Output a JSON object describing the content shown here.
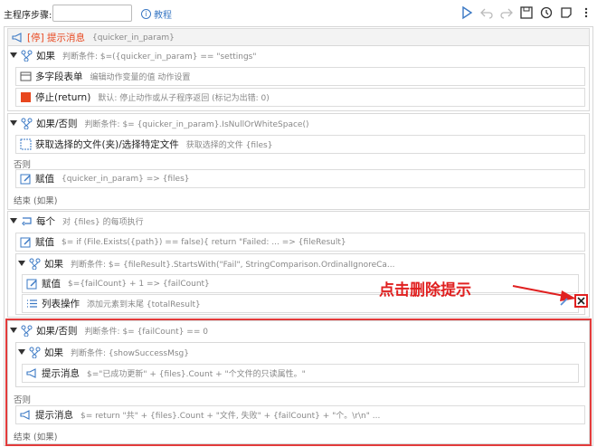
{
  "toolbar": {
    "label": "主程序步骤:",
    "search_value": "",
    "help_label": "教程"
  },
  "steps": {
    "s1": {
      "title": "[停] 提示消息",
      "desc": "{quicker_in_param}"
    },
    "s2": {
      "title": "如果",
      "desc": "判断条件: $=({quicker_in_param} == \"settings\""
    },
    "s2a": {
      "title": "多字段表单",
      "desc": "编辑动作变量的值 动作设置"
    },
    "s2b": {
      "title": "停止(return)",
      "desc": "默认:  停止动作或从子程序返回 (标记为出错: 0)"
    },
    "s3": {
      "title": "如果/否则",
      "desc": "判断条件: $= {quicker_in_param}.IsNullOrWhiteSpace()"
    },
    "s3a": {
      "title": "获取选择的文件(夹)/选择特定文件",
      "desc": "获取选择的文件 {files}"
    },
    "s3_else": "否则",
    "s3b": {
      "title": "赋值",
      "desc": "{quicker_in_param} => {files}"
    },
    "s3_end": "结束 (如果)",
    "s4": {
      "title": "每个",
      "desc": "对 {files} 的每项执行"
    },
    "s4a": {
      "title": "赋值",
      "desc": "$=  if (File.Exists({path}) == false){             return \"Failed: ... => {fileResult}"
    },
    "s4b": {
      "title": "如果",
      "desc": "判断条件: $= {fileResult}.StartsWith(\"Fail\", StringComparison.OrdinalIgnoreCa..."
    },
    "s4b1": {
      "title": "赋值",
      "desc": "$={failCount} + 1 => {failCount}"
    },
    "s4b2": {
      "title": "列表操作",
      "desc": "添加元素到末尾 {totalResult}"
    },
    "s5": {
      "title": "如果/否则",
      "desc": "判断条件: $= {failCount} == 0"
    },
    "s5a": {
      "title": "如果",
      "desc": "判断条件: {showSuccessMsg}"
    },
    "s5a1": {
      "title": "提示消息",
      "desc": "$=\"已成功更新\" + {files}.Count + \"个文件的只读属性。\""
    },
    "s5_else": "否则",
    "s5b": {
      "title": "提示消息",
      "desc": "$=  return \"共\" + {files}.Count + \"文件, 失败\" + {failCount} + \"个。\\r\\n\"  ..."
    },
    "s5_end": "结束 (如果)"
  },
  "annotation": {
    "text": "点击删除提示"
  },
  "colors": {
    "accent": "#3a78c4",
    "stop": "#e8471f",
    "highlight": "#e23b3b"
  }
}
